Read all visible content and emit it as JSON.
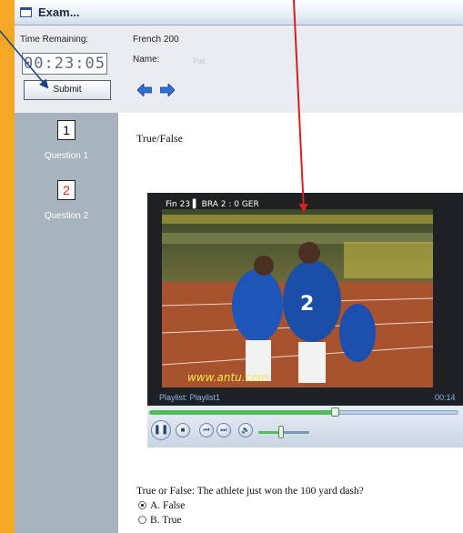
{
  "window": {
    "title": "Exam..."
  },
  "sidebar": {
    "time_label": "Time Remaining:",
    "timer": "00:23:05",
    "submit_label": "Submit",
    "questions": [
      {
        "number": "1",
        "label": "Question 1",
        "number_color": "#111111"
      },
      {
        "number": "2",
        "label": "Question 2",
        "number_color": "#e02020"
      }
    ]
  },
  "header": {
    "course": "French 200",
    "name_label": "Name:",
    "name_value": "Pat"
  },
  "content": {
    "question_type": "True/False",
    "question_text": "True or False: The athlete just won the 100 yard dash?",
    "options": [
      {
        "label": "A. False",
        "selected": true
      },
      {
        "label": "B. True",
        "selected": false
      }
    ]
  },
  "player": {
    "watermark": "www.antu.com",
    "playlist": "Playlist: Playlist1",
    "time": "00:14",
    "progress": 0.6,
    "volume": 0.45
  },
  "colors": {
    "accent_orange": "#f5a623",
    "annotation_arrow": "#d42020",
    "sidebar_gray": "#a7b3be"
  }
}
